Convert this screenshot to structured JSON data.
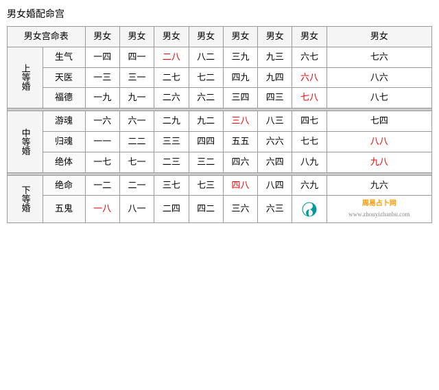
{
  "title": "男女婚配命宫",
  "table": {
    "header": {
      "col0": "男女宫命表",
      "cols": [
        "男女",
        "男女",
        "男女",
        "男女",
        "男女",
        "男女",
        "男女",
        "男女"
      ]
    },
    "groups": [
      {
        "groupLabel": "上等婚",
        "rows": [
          {
            "subLabel": "生气",
            "cells": [
              {
                "text": "一四",
                "red": false
              },
              {
                "text": "四一",
                "red": false
              },
              {
                "text": "二八",
                "red": true
              },
              {
                "text": "八二",
                "red": false
              },
              {
                "text": "三九",
                "red": false
              },
              {
                "text": "九三",
                "red": false
              },
              {
                "text": "六七",
                "red": false
              },
              {
                "text": "七六",
                "red": false
              }
            ]
          },
          {
            "subLabel": "天医",
            "cells": [
              {
                "text": "一三",
                "red": false
              },
              {
                "text": "三一",
                "red": false
              },
              {
                "text": "二七",
                "red": false
              },
              {
                "text": "七二",
                "red": false
              },
              {
                "text": "四九",
                "red": false
              },
              {
                "text": "九四",
                "red": false
              },
              {
                "text": "六八",
                "red": true
              },
              {
                "text": "八六",
                "red": false
              }
            ]
          },
          {
            "subLabel": "福德",
            "cells": [
              {
                "text": "一九",
                "red": false
              },
              {
                "text": "九一",
                "red": false
              },
              {
                "text": "二六",
                "red": false
              },
              {
                "text": "六二",
                "red": false
              },
              {
                "text": "三四",
                "red": false
              },
              {
                "text": "四三",
                "red": false
              },
              {
                "text": "七八",
                "red": true
              },
              {
                "text": "八七",
                "red": false
              }
            ]
          }
        ]
      },
      {
        "groupLabel": "中等婚",
        "rows": [
          {
            "subLabel": "游魂",
            "cells": [
              {
                "text": "一六",
                "red": false
              },
              {
                "text": "六一",
                "red": false
              },
              {
                "text": "二九",
                "red": false
              },
              {
                "text": "九二",
                "red": false
              },
              {
                "text": "三八",
                "red": true
              },
              {
                "text": "八三",
                "red": false
              },
              {
                "text": "四七",
                "red": false
              },
              {
                "text": "七四",
                "red": false
              }
            ]
          },
          {
            "subLabel": "归魂",
            "cells": [
              {
                "text": "一一",
                "red": false
              },
              {
                "text": "二二",
                "red": false
              },
              {
                "text": "三三",
                "red": false
              },
              {
                "text": "四四",
                "red": false
              },
              {
                "text": "五五",
                "red": false
              },
              {
                "text": "六六",
                "red": false
              },
              {
                "text": "七七",
                "red": false
              },
              {
                "text": "八八",
                "red": true
              }
            ]
          },
          {
            "subLabel": "绝体",
            "cells": [
              {
                "text": "一七",
                "red": false
              },
              {
                "text": "七一",
                "red": false
              },
              {
                "text": "二三",
                "red": false
              },
              {
                "text": "三二",
                "red": false
              },
              {
                "text": "四六",
                "red": false
              },
              {
                "text": "六四",
                "red": false
              },
              {
                "text": "八九",
                "red": false
              },
              {
                "text": "九八",
                "red": true
              }
            ]
          }
        ]
      },
      {
        "groupLabel": "下等婚",
        "rows": [
          {
            "subLabel": "绝命",
            "cells": [
              {
                "text": "一二",
                "red": false
              },
              {
                "text": "二一",
                "red": false
              },
              {
                "text": "三七",
                "red": false
              },
              {
                "text": "七三",
                "red": false
              },
              {
                "text": "四八",
                "red": true
              },
              {
                "text": "八四",
                "red": false
              },
              {
                "text": "六九",
                "red": false
              },
              {
                "text": "九六",
                "red": false
              }
            ]
          },
          {
            "subLabel": "五鬼",
            "cells": [
              {
                "text": "一八",
                "red": true
              },
              {
                "text": "八一",
                "red": false
              },
              {
                "text": "二四",
                "red": false
              },
              {
                "text": "四二",
                "red": false
              },
              {
                "text": "三六",
                "red": false
              },
              {
                "text": "六三",
                "red": false,
                "teal": false
              },
              {
                "text": "logo",
                "isLogo": true
              },
              {
                "text": "",
                "isBlank": true
              }
            ]
          }
        ]
      }
    ]
  },
  "watermark": {
    "site": "周易占卜网",
    "url": "www.zhouyizhanbu.com"
  }
}
